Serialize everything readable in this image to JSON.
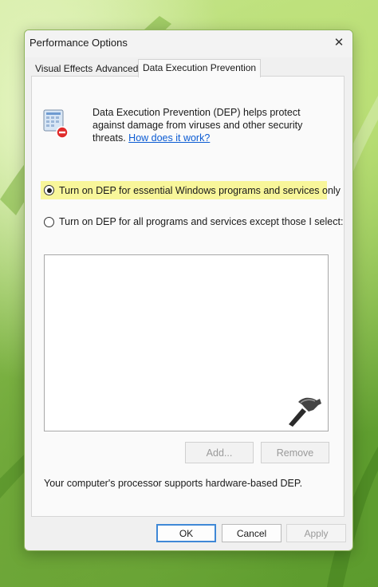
{
  "window": {
    "title": "Performance Options",
    "close_symbol": "✕"
  },
  "tabs": [
    {
      "label": "Visual Effects"
    },
    {
      "label": "Advanced"
    },
    {
      "label": "Data Execution Prevention"
    }
  ],
  "description": {
    "text": "Data Execution Prevention (DEP) helps protect against damage from viruses and other security threats. ",
    "link": "How does it work?"
  },
  "options": {
    "essential_label": "Turn on DEP for essential Windows programs and services only",
    "all_label": "Turn on DEP for all programs and services except those I select:",
    "selected": "essential"
  },
  "list_buttons": {
    "add_label": "Add...",
    "remove_label": "Remove"
  },
  "support_text": "Your computer's processor supports hardware-based DEP.",
  "footer": {
    "ok_label": "OK",
    "cancel_label": "Cancel",
    "apply_label": "Apply"
  },
  "icons": {
    "dep": "dep-shield-icon",
    "close": "close-icon",
    "watermark": "hammer-logo-icon"
  },
  "colors": {
    "highlight": "#f8f69a",
    "link": "#0b5bd3",
    "ok_border": "#3f88d6"
  }
}
